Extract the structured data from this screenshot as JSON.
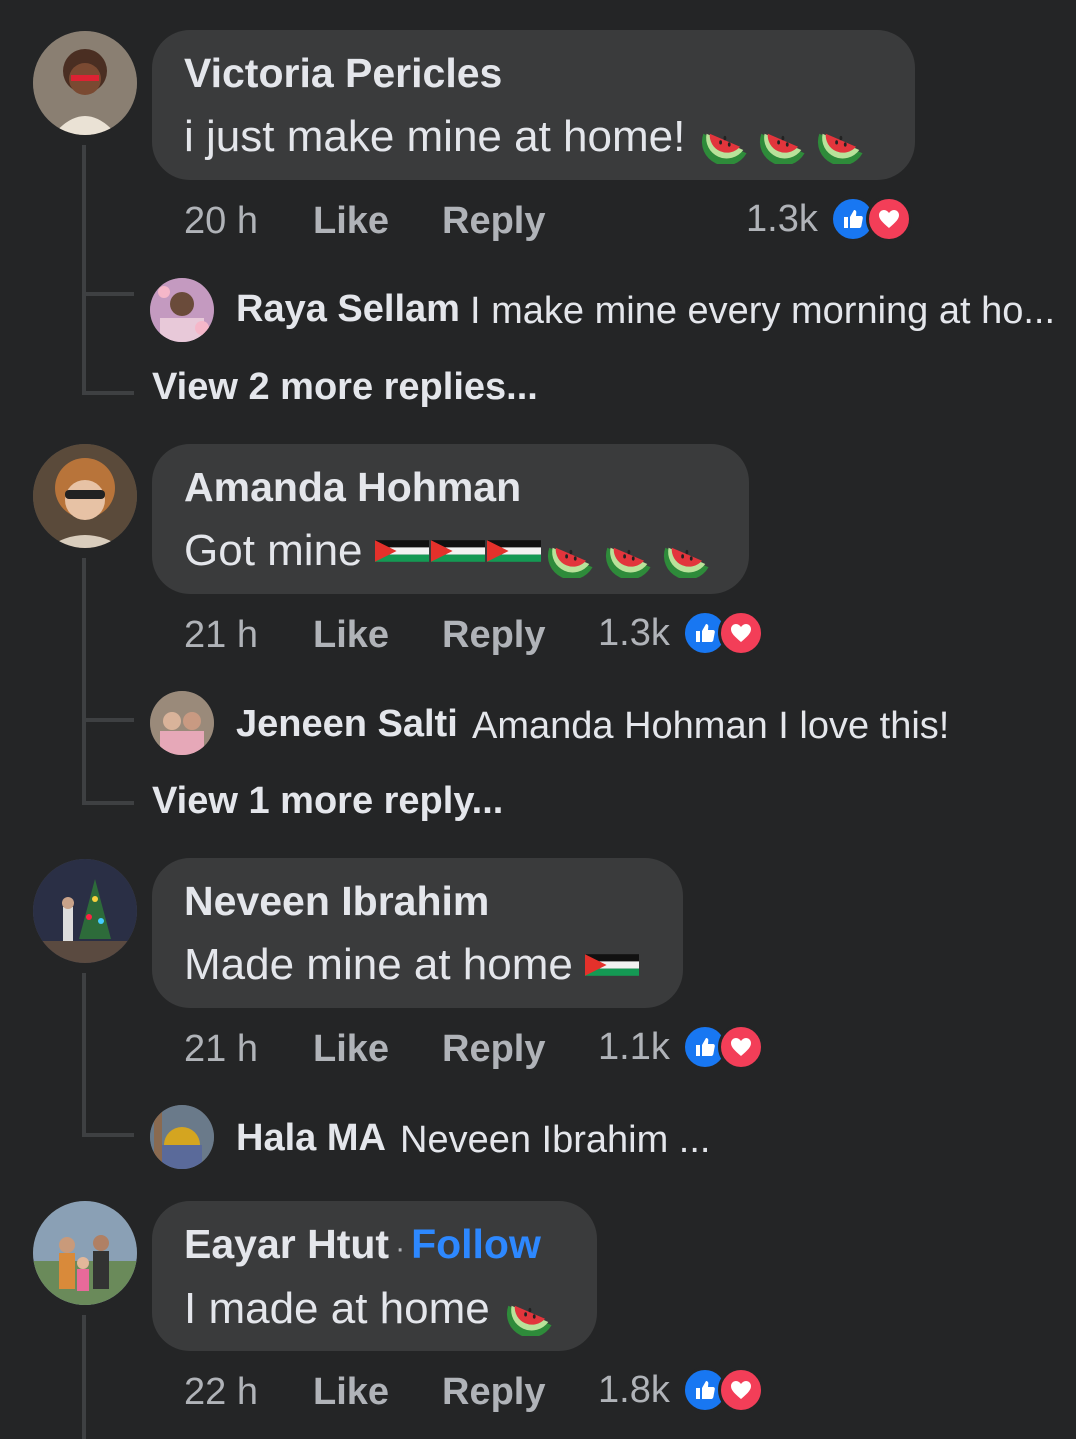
{
  "comments": [
    {
      "author": "Victoria Pericles",
      "text": "i just make mine at home!",
      "emojis": [
        "watermelon-icon",
        "watermelon-icon",
        "watermelon-icon"
      ],
      "time": "20 h",
      "like_label": "Like",
      "reply_label": "Reply",
      "reaction_count": "1.3k",
      "reply": {
        "author": "Raya Sellam",
        "text": "I make mine every morning at ho..."
      },
      "view_more": "View 2 more replies..."
    },
    {
      "author": "Amanda Hohman",
      "text": "Got mine",
      "emojis": [
        "palestine-flag-icon",
        "palestine-flag-icon",
        "palestine-flag-icon",
        "watermelon-icon",
        "watermelon-icon",
        "watermelon-icon"
      ],
      "time": "21 h",
      "like_label": "Like",
      "reply_label": "Reply",
      "reaction_count": "1.3k",
      "reply": {
        "author": "Jeneen Salti",
        "text": "Amanda Hohman I love this!"
      },
      "view_more": "View 1 more reply..."
    },
    {
      "author": "Neveen Ibrahim",
      "text": "Made mine at home",
      "emojis": [
        "palestine-flag-icon"
      ],
      "time": "21 h",
      "like_label": "Like",
      "reply_label": "Reply",
      "reaction_count": "1.1k",
      "reply": {
        "author": "Hala MA",
        "text": "Neveen Ibrahim ..."
      }
    },
    {
      "author": "Eayar Htut",
      "follow_label": "Follow",
      "text": "I made at home",
      "emojis": [
        "watermelon-icon"
      ],
      "time": "22 h",
      "like_label": "Like",
      "reply_label": "Reply",
      "reaction_count": "1.8k"
    }
  ],
  "colors": {
    "background": "#242526",
    "bubble": "#3a3b3c",
    "like_blue": "#1877f2",
    "love_red": "#f33e58",
    "follow_blue": "#2d88ff"
  }
}
